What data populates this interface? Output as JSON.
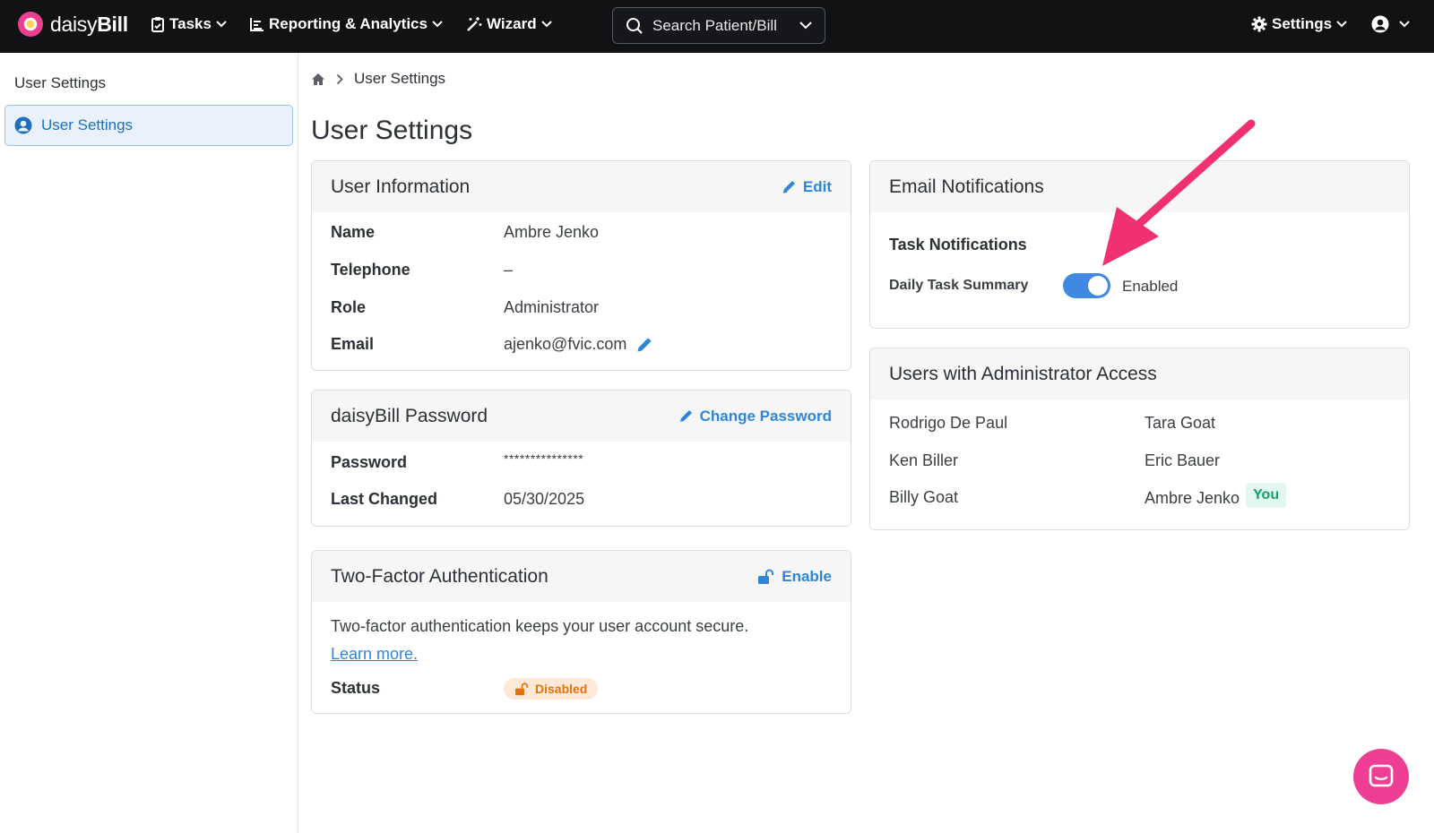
{
  "nav": {
    "brand_light": "daisy",
    "brand_bold": "Bill",
    "tasks": "Tasks",
    "reporting": "Reporting & Analytics",
    "wizard": "Wizard",
    "search_placeholder": "Search Patient/Bill",
    "settings": "Settings"
  },
  "sidebar": {
    "title": "User Settings",
    "items": [
      {
        "label": "User Settings",
        "active": true
      }
    ]
  },
  "breadcrumb": {
    "current": "User Settings"
  },
  "page_title": "User Settings",
  "user_info": {
    "title": "User Information",
    "edit_label": "Edit",
    "rows": [
      {
        "label": "Name",
        "value": "Ambre Jenko"
      },
      {
        "label": "Telephone",
        "value": "–"
      },
      {
        "label": "Role",
        "value": "Administrator"
      },
      {
        "label": "Email",
        "value": "ajenko@fvic.com"
      }
    ]
  },
  "password": {
    "title": "daisyBill Password",
    "change_label": "Change Password",
    "rows": [
      {
        "label": "Password",
        "value": "***************"
      },
      {
        "label": "Last Changed",
        "value": "05/30/2025"
      }
    ]
  },
  "tfa": {
    "title": "Two-Factor Authentication",
    "enable_label": "Enable",
    "description": "Two-factor authentication keeps your user account secure.",
    "learn_more": "Learn more.",
    "status_label": "Status",
    "status_value": "Disabled"
  },
  "email_notifications": {
    "title": "Email Notifications",
    "section": "Task Notifications",
    "daily_label": "Daily Task Summary",
    "daily_enabled": true,
    "daily_state": "Enabled"
  },
  "admins": {
    "title": "Users with Administrator Access",
    "left": [
      "Rodrigo De Paul",
      "Ken Biller",
      "Billy Goat"
    ],
    "right": [
      "Tara Goat",
      "Eric Bauer",
      "Ambre Jenko"
    ],
    "you_badge": "You"
  },
  "colors": {
    "accent": "#2f86d8",
    "brand_pink": "#ee3f94",
    "topbar": "#111214",
    "toggle_on": "#3f8ae0",
    "disabled_badge": "#e0730f",
    "you_badge": "#17a06b"
  }
}
